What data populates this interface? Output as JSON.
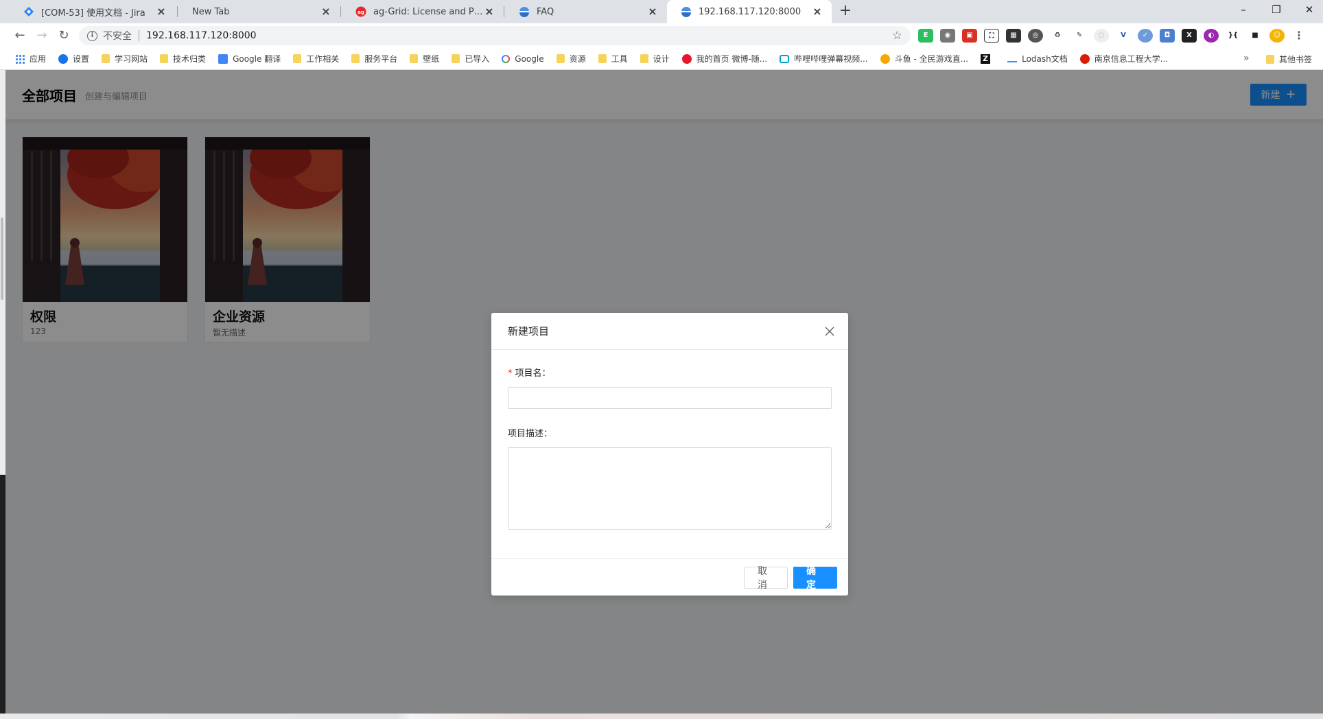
{
  "browser": {
    "tabs": [
      {
        "title": "[COM-53] 使用文档 - Jira",
        "favicon": "jira-icon",
        "active": false
      },
      {
        "title": "New Tab",
        "favicon": "",
        "active": false
      },
      {
        "title": "ag-Grid: License and Pricing",
        "favicon": "ag-grid-icon",
        "active": false
      },
      {
        "title": "FAQ",
        "favicon": "globe-icon",
        "active": false
      },
      {
        "title": "192.168.117.120:8000",
        "favicon": "globe-icon",
        "active": true
      }
    ],
    "address": {
      "security_label": "不安全",
      "url": "192.168.117.120:8000"
    },
    "bookmarks": [
      {
        "label": "应用",
        "icon": "apps-icon"
      },
      {
        "label": "设置",
        "icon": "gear-icon"
      },
      {
        "label": "学习网站",
        "icon": "folder-icon"
      },
      {
        "label": "技术归类",
        "icon": "folder-icon"
      },
      {
        "label": "Google 翻译",
        "icon": "translate-icon"
      },
      {
        "label": "工作相关",
        "icon": "folder-icon"
      },
      {
        "label": "服务平台",
        "icon": "folder-icon"
      },
      {
        "label": "壁纸",
        "icon": "folder-icon"
      },
      {
        "label": "已导入",
        "icon": "folder-icon"
      },
      {
        "label": "Google",
        "icon": "google-icon"
      },
      {
        "label": "资源",
        "icon": "folder-icon"
      },
      {
        "label": "工具",
        "icon": "folder-icon"
      },
      {
        "label": "设计",
        "icon": "folder-icon"
      },
      {
        "label": "我的首页 微博-随...",
        "icon": "weibo-icon"
      },
      {
        "label": "哔哩哔哩弹幕视频...",
        "icon": "bilibili-icon"
      },
      {
        "label": "斗鱼 - 全民游戏直...",
        "icon": "douyu-icon"
      },
      {
        "label": "",
        "icon": "zhihu-z-icon"
      },
      {
        "label": "Lodash文档",
        "icon": "lodash-icon"
      },
      {
        "label": "南京信息工程大学...",
        "icon": "university-icon"
      }
    ],
    "bookmarks_more": "»",
    "other_bookmarks": "其他书签"
  },
  "page": {
    "title": "全部项目",
    "subtitle": "创建与编辑项目",
    "new_button": "新建",
    "new_button_icon": "plus-icon",
    "projects": [
      {
        "name": "权限",
        "description": "123"
      },
      {
        "name": "企业资源",
        "description": "暂无描述"
      }
    ]
  },
  "modal": {
    "title": "新建项目",
    "fields": {
      "name_label": "项目名：",
      "name_value": "",
      "desc_label": "项目描述：",
      "desc_value": ""
    },
    "cancel_label": "取 消",
    "ok_label": "确 定"
  },
  "colors": {
    "primary": "#1890ff",
    "required": "#f5222d",
    "mask": "rgba(0,0,0,0.45)"
  }
}
